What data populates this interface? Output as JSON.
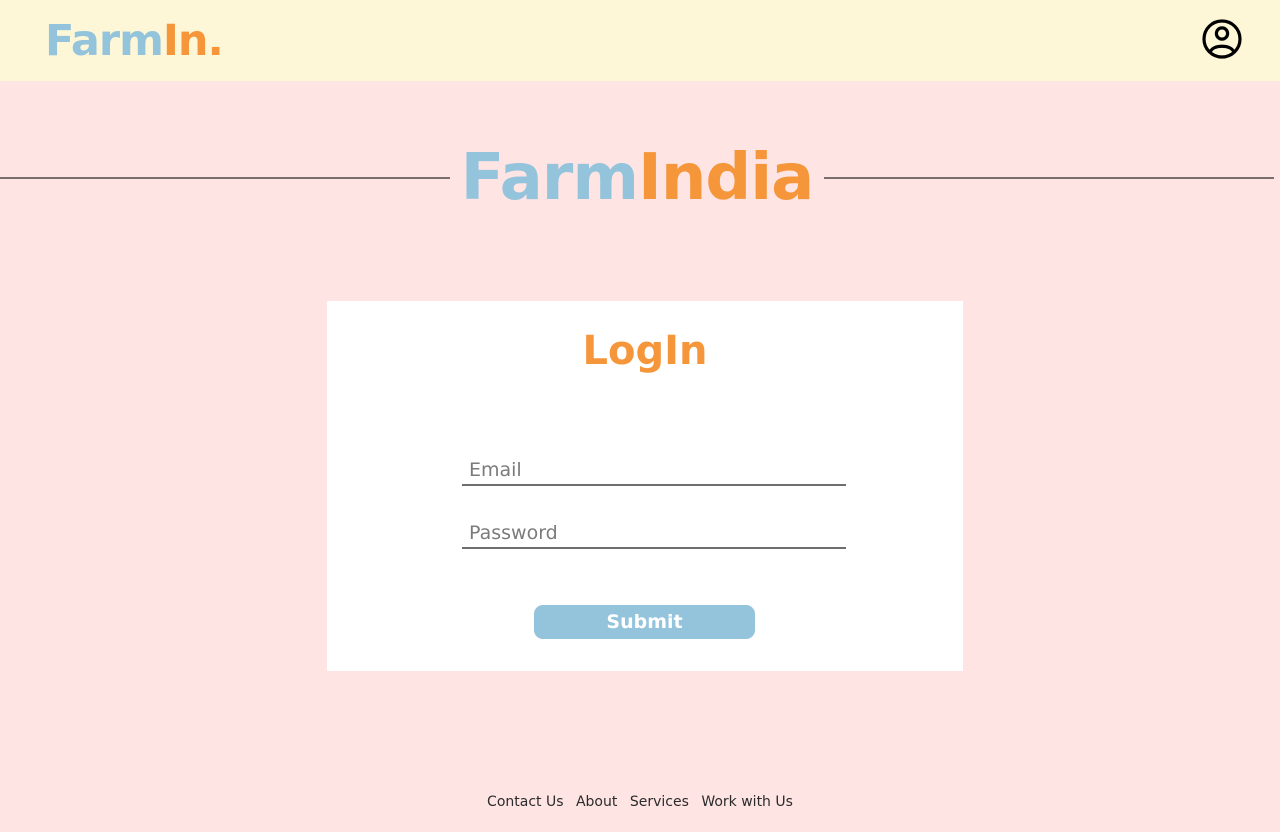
{
  "header": {
    "logo": {
      "part1": "Farm",
      "part2": "In."
    },
    "profile_icon": "user-circle-icon"
  },
  "hero": {
    "title_part1": "Farm",
    "title_part2": "India"
  },
  "login": {
    "title": "LogIn",
    "email_placeholder": "Email",
    "email_value": "",
    "password_placeholder": "Password",
    "password_value": "",
    "submit_label": "Submit"
  },
  "footer": {
    "links": [
      "Contact Us",
      "About",
      "Services",
      "Work with Us"
    ]
  },
  "colors": {
    "page_bg": "#ffe4e4",
    "header_bg": "#fdf7d7",
    "brand_blue": "#94c3dc",
    "brand_orange": "#f5963a",
    "card_bg": "#ffffff"
  }
}
